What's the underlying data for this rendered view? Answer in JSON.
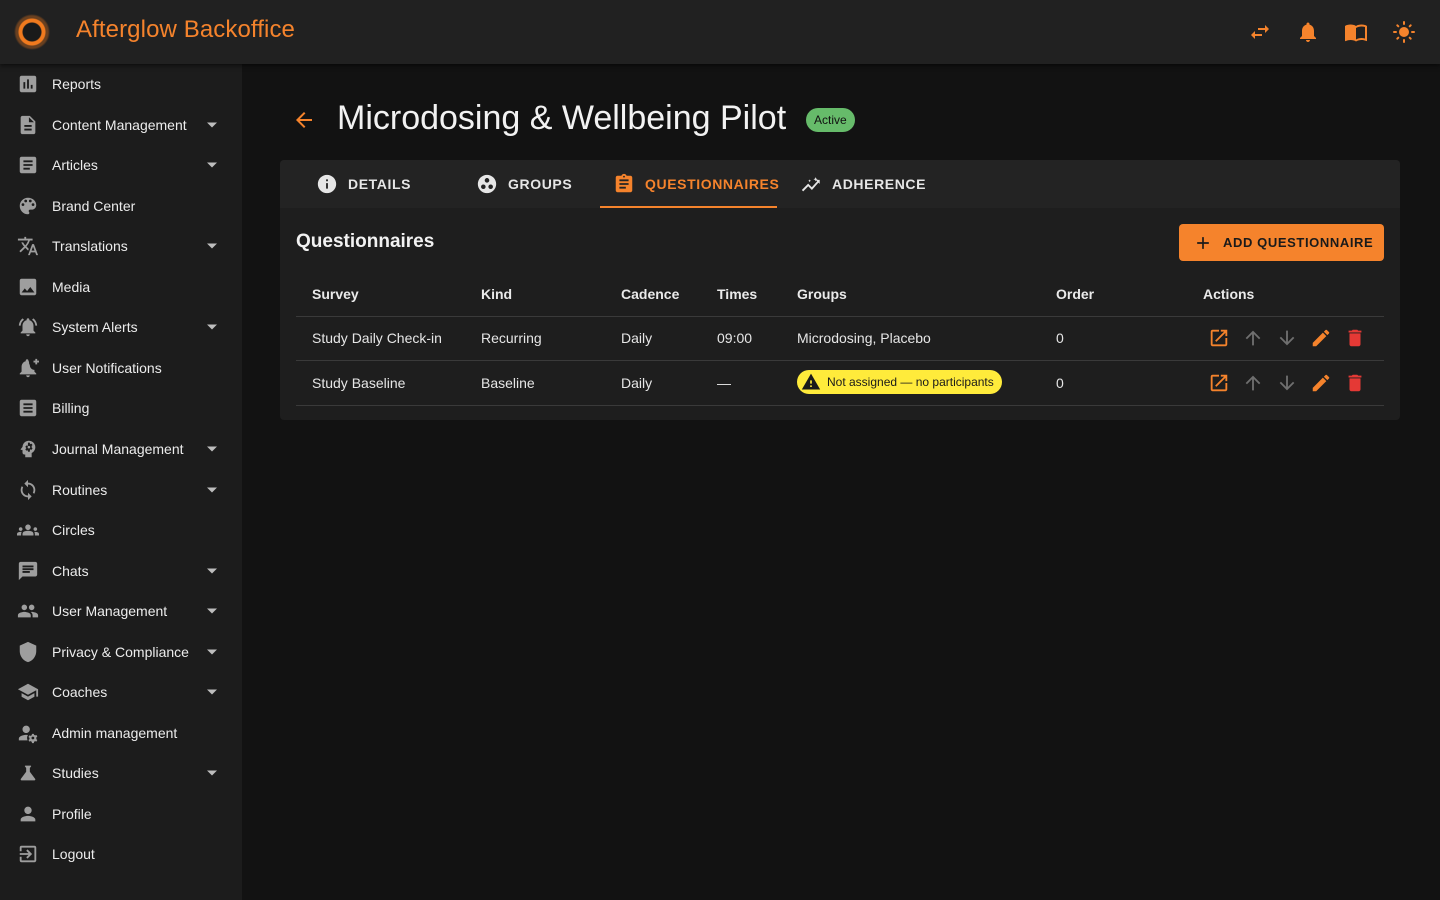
{
  "app": {
    "title": "Afterglow Backoffice"
  },
  "topbar": {
    "actions": [
      {
        "name": "switch-icon"
      },
      {
        "name": "bell-icon"
      },
      {
        "name": "book-icon"
      },
      {
        "name": "sun-icon"
      }
    ]
  },
  "sidebar": {
    "items": [
      {
        "label": "Reports",
        "icon": "reports-icon",
        "expandable": false
      },
      {
        "label": "Content Management",
        "icon": "document-icon",
        "expandable": true
      },
      {
        "label": "Articles",
        "icon": "article-icon",
        "expandable": true
      },
      {
        "label": "Brand Center",
        "icon": "palette-icon",
        "expandable": false
      },
      {
        "label": "Translations",
        "icon": "translate-icon",
        "expandable": true
      },
      {
        "label": "Media",
        "icon": "image-icon",
        "expandable": false
      },
      {
        "label": "System Alerts",
        "icon": "alarm-icon",
        "expandable": true
      },
      {
        "label": "User Notifications",
        "icon": "notification-add-icon",
        "expandable": false
      },
      {
        "label": "Billing",
        "icon": "receipt-icon",
        "expandable": false
      },
      {
        "label": "Journal Management",
        "icon": "psychology-icon",
        "expandable": true
      },
      {
        "label": "Routines",
        "icon": "sync-icon",
        "expandable": true
      },
      {
        "label": "Circles",
        "icon": "groups-icon",
        "expandable": false
      },
      {
        "label": "Chats",
        "icon": "chat-icon",
        "expandable": true
      },
      {
        "label": "User Management",
        "icon": "people-icon",
        "expandable": true
      },
      {
        "label": "Privacy & Compliance",
        "icon": "shield-icon",
        "expandable": true
      },
      {
        "label": "Coaches",
        "icon": "school-icon",
        "expandable": true
      },
      {
        "label": "Admin management",
        "icon": "admin-icon",
        "expandable": false
      },
      {
        "label": "Studies",
        "icon": "flask-icon",
        "expandable": true
      },
      {
        "label": "Profile",
        "icon": "person-icon",
        "expandable": false
      },
      {
        "label": "Logout",
        "icon": "logout-icon",
        "expandable": false
      }
    ]
  },
  "page": {
    "title": "Microdosing & Wellbeing Pilot",
    "status": "Active",
    "status_color": "#66bb6a"
  },
  "tabs": [
    {
      "label": "DETAILS",
      "icon": "info-icon",
      "active": false
    },
    {
      "label": "GROUPS",
      "icon": "groups-circle-icon",
      "active": false
    },
    {
      "label": "QUESTIONNAIRES",
      "icon": "clipboard-icon",
      "active": true
    },
    {
      "label": "ADHERENCE",
      "icon": "trend-icon",
      "active": false
    }
  ],
  "questionnaires": {
    "title": "Questionnaires",
    "add_label": "ADD QUESTIONNAIRE",
    "columns": [
      "Survey",
      "Kind",
      "Cadence",
      "Times",
      "Groups",
      "Order",
      "Actions"
    ],
    "rows": [
      {
        "survey": "Study Daily Check-in",
        "kind": "Recurring",
        "cadence": "Daily",
        "times": "09:00",
        "groups": "Microdosing, Placebo",
        "order": "0"
      },
      {
        "survey": "Study Baseline",
        "kind": "Baseline",
        "cadence": "Daily",
        "times": "—",
        "groups_warning": "Not assigned — no participants",
        "order": "0"
      }
    ]
  },
  "colors": {
    "accent": "#f5832c",
    "danger": "#e53935",
    "warning": "#ffeb3b"
  }
}
